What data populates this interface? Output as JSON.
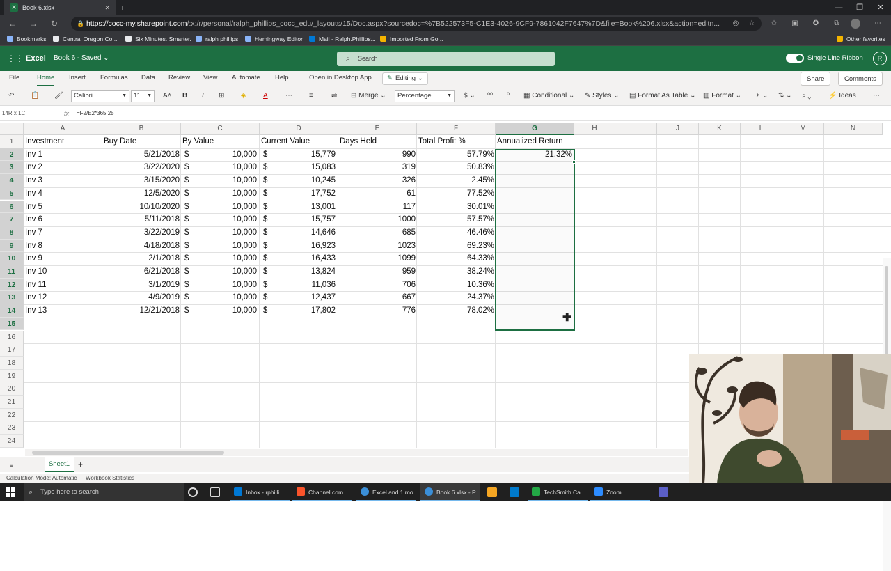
{
  "browser": {
    "tab_title": "Book 6.xlsx",
    "tab_icon_glyph": "X",
    "url_host": "https://cocc-my.sharepoint.com",
    "url_path": "/:x:/r/personal/ralph_phillips_cocc_edu/_layouts/15/Doc.aspx?sourcedoc=%7B522573F5-C1E3-4026-9CF9-7861042F7647%7D&file=Book%206.xlsx&action=editn...",
    "bookmarks": [
      {
        "label": "Bookmarks",
        "color": "#8ab4f8"
      },
      {
        "label": "Central Oregon Co...",
        "color": "#e8eaed"
      },
      {
        "label": "Six Minutes. Smarter.",
        "color": "#e8eaed"
      },
      {
        "label": "ralph phillips",
        "color": "#8ab4f8"
      },
      {
        "label": "Hemingway Editor",
        "color": "#8ab4f8"
      },
      {
        "label": "Mail - Ralph.Phillips...",
        "color": "#0078d4"
      },
      {
        "label": "Imported From Go...",
        "color": "#f4b400"
      }
    ],
    "other_favorites": "Other favorites"
  },
  "excel": {
    "app_name": "Excel",
    "doc_name": "Book 6 - Saved",
    "search_placeholder": "Search",
    "single_line_ribbon": "Single Line Ribbon",
    "avatar_initial": "R",
    "menu_tabs": [
      "File",
      "Home",
      "Insert",
      "Formulas",
      "Data",
      "Review",
      "View",
      "Automate",
      "Help"
    ],
    "active_tab": "Home",
    "open_desktop": "Open in Desktop App",
    "editing": "Editing",
    "share": "Share",
    "comments": "Comments",
    "font_name": "Calibri",
    "font_size": "11",
    "merge": "Merge",
    "number_format": "Percentage",
    "conditional": "Conditional",
    "styles": "Styles",
    "format_as_table": "Format As Table",
    "format": "Format",
    "ideas": "Ideas",
    "name_box": "14R x 1C",
    "fx": "fx",
    "formula": "=F2/E2*365.25",
    "accent": "#1d6f42"
  },
  "sheet": {
    "columns": [
      "A",
      "B",
      "C",
      "D",
      "E",
      "F",
      "G",
      "H",
      "I",
      "J",
      "K",
      "L",
      "M",
      "N"
    ],
    "selected_column": "G",
    "row_numbers": [
      "1",
      "2",
      "3",
      "4",
      "5",
      "6",
      "7",
      "8",
      "9",
      "10",
      "11",
      "12",
      "13",
      "14",
      "15",
      "16",
      "17",
      "18",
      "19",
      "20",
      "21",
      "22",
      "23",
      "24"
    ],
    "headers": [
      "Investment",
      "Buy Date",
      "By Value",
      "Current Value",
      "Days Held",
      "Total Profit %",
      "Annualized Return"
    ],
    "rows": [
      {
        "inv": "Inv 1",
        "date": "5/21/2018",
        "by_cur": "$",
        "by": "10,000",
        "cv_cur": "$",
        "cv": "15,779",
        "days": "990",
        "profit": "57.79%",
        "ann": "21.32%"
      },
      {
        "inv": "Inv 2",
        "date": "3/22/2020",
        "by_cur": "$",
        "by": "10,000",
        "cv_cur": "$",
        "cv": "15,083",
        "days": "319",
        "profit": "50.83%",
        "ann": ""
      },
      {
        "inv": "Inv 3",
        "date": "3/15/2020",
        "by_cur": "$",
        "by": "10,000",
        "cv_cur": "$",
        "cv": "10,245",
        "days": "326",
        "profit": "2.45%",
        "ann": ""
      },
      {
        "inv": "Inv 4",
        "date": "12/5/2020",
        "by_cur": "$",
        "by": "10,000",
        "cv_cur": "$",
        "cv": "17,752",
        "days": "61",
        "profit": "77.52%",
        "ann": ""
      },
      {
        "inv": "Inv 5",
        "date": "10/10/2020",
        "by_cur": "$",
        "by": "10,000",
        "cv_cur": "$",
        "cv": "13,001",
        "days": "117",
        "profit": "30.01%",
        "ann": ""
      },
      {
        "inv": "Inv 6",
        "date": "5/11/2018",
        "by_cur": "$",
        "by": "10,000",
        "cv_cur": "$",
        "cv": "15,757",
        "days": "1000",
        "profit": "57.57%",
        "ann": ""
      },
      {
        "inv": "Inv 7",
        "date": "3/22/2019",
        "by_cur": "$",
        "by": "10,000",
        "cv_cur": "$",
        "cv": "14,646",
        "days": "685",
        "profit": "46.46%",
        "ann": ""
      },
      {
        "inv": "Inv 8",
        "date": "4/18/2018",
        "by_cur": "$",
        "by": "10,000",
        "cv_cur": "$",
        "cv": "16,923",
        "days": "1023",
        "profit": "69.23%",
        "ann": ""
      },
      {
        "inv": "Inv 9",
        "date": "2/1/2018",
        "by_cur": "$",
        "by": "10,000",
        "cv_cur": "$",
        "cv": "16,433",
        "days": "1099",
        "profit": "64.33%",
        "ann": ""
      },
      {
        "inv": "Inv 10",
        "date": "6/21/2018",
        "by_cur": "$",
        "by": "10,000",
        "cv_cur": "$",
        "cv": "13,824",
        "days": "959",
        "profit": "38.24%",
        "ann": ""
      },
      {
        "inv": "Inv 11",
        "date": "3/1/2019",
        "by_cur": "$",
        "by": "10,000",
        "cv_cur": "$",
        "cv": "11,036",
        "days": "706",
        "profit": "10.36%",
        "ann": ""
      },
      {
        "inv": "Inv 12",
        "date": "4/9/2019",
        "by_cur": "$",
        "by": "10,000",
        "cv_cur": "$",
        "cv": "12,437",
        "days": "667",
        "profit": "24.37%",
        "ann": ""
      },
      {
        "inv": "Inv 13",
        "date": "12/21/2018",
        "by_cur": "$",
        "by": "10,000",
        "cv_cur": "$",
        "cv": "17,802",
        "days": "776",
        "profit": "78.02%",
        "ann": ""
      }
    ],
    "sheet_tab": "Sheet1",
    "add_sheet": "+",
    "status_calc": "Calculation Mode: Automatic",
    "status_stats": "Workbook Statistics"
  },
  "taskbar": {
    "search_placeholder": "Type here to search",
    "apps": [
      {
        "label": "Inbox - rphilli...",
        "color": "#0078d4"
      },
      {
        "label": "Channel com...",
        "color": "#fb542b"
      },
      {
        "label": "Excel and 1 mo...",
        "color": "#3b8fd8"
      },
      {
        "label": "Book 6.xlsx - P...",
        "color": "#3b8fd8"
      },
      {
        "label": "TechSmith Ca...",
        "color": "#23a845"
      },
      {
        "label": "Zoom",
        "color": "#2d8cff"
      }
    ]
  }
}
